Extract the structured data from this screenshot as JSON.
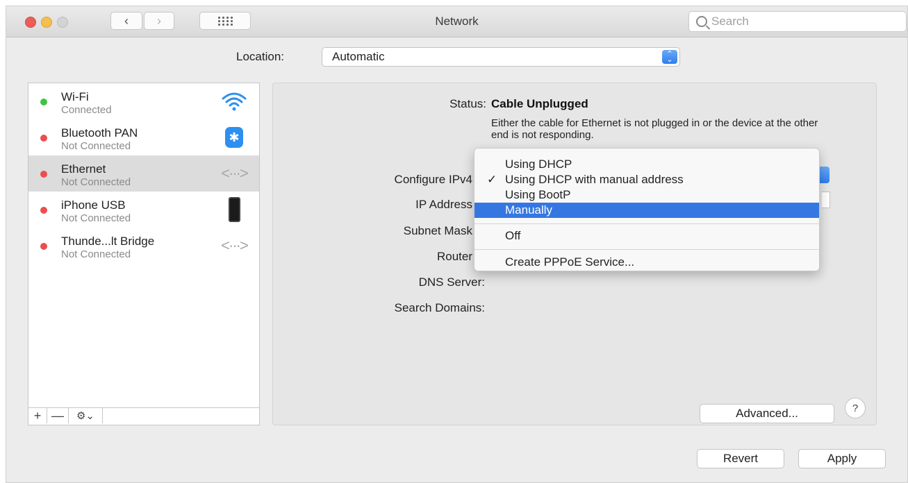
{
  "window": {
    "title": "Network",
    "search_placeholder": "Search"
  },
  "location": {
    "label": "Location:",
    "value": "Automatic"
  },
  "services": [
    {
      "name": "Wi-Fi",
      "status": "Connected",
      "status_color": "#3ec340",
      "icon": "wifi-icon"
    },
    {
      "name": "Bluetooth PAN",
      "status": "Not Connected",
      "status_color": "#ec4e4e",
      "icon": "bluetooth-icon"
    },
    {
      "name": "Ethernet",
      "status": "Not Connected",
      "status_color": "#ec4e4e",
      "icon": "ethernet-icon",
      "selected": true
    },
    {
      "name": "iPhone USB",
      "status": "Not Connected",
      "status_color": "#ec4e4e",
      "icon": "iphone-icon"
    },
    {
      "name": "Thunde...lt Bridge",
      "status": "Not Connected",
      "status_color": "#ec4e4e",
      "icon": "thunderbolt-bridge-icon"
    }
  ],
  "sidebar_toolbar": {
    "add": "+",
    "remove": "—",
    "gear_menu": "⚙⌄"
  },
  "detail": {
    "status_label": "Status:",
    "status_value": "Cable Unplugged",
    "status_description": "Either the cable for Ethernet is not plugged in or the device at the other end is not responding.",
    "configure_label": "Configure IPv4",
    "ip_label": "IP Address",
    "subnet_label": "Subnet Mask",
    "router_label": "Router",
    "dns_label": "DNS Server:",
    "search_domains_label": "Search Domains:"
  },
  "menu": {
    "items": [
      {
        "label": "Using DHCP",
        "checked": false
      },
      {
        "label": "Using DHCP with manual address",
        "checked": true,
        "check": "✓"
      },
      {
        "label": "Using BootP",
        "checked": false
      },
      {
        "label": "Manually",
        "highlighted": true
      },
      {
        "label": "Off"
      },
      {
        "label": "Create PPPoE Service..."
      }
    ]
  },
  "buttons": {
    "advanced": "Advanced...",
    "help": "?",
    "revert": "Revert",
    "apply": "Apply"
  },
  "colors": {
    "accent": "#3477e3",
    "connected": "#3ec340",
    "disconnected": "#ec4e4e"
  }
}
